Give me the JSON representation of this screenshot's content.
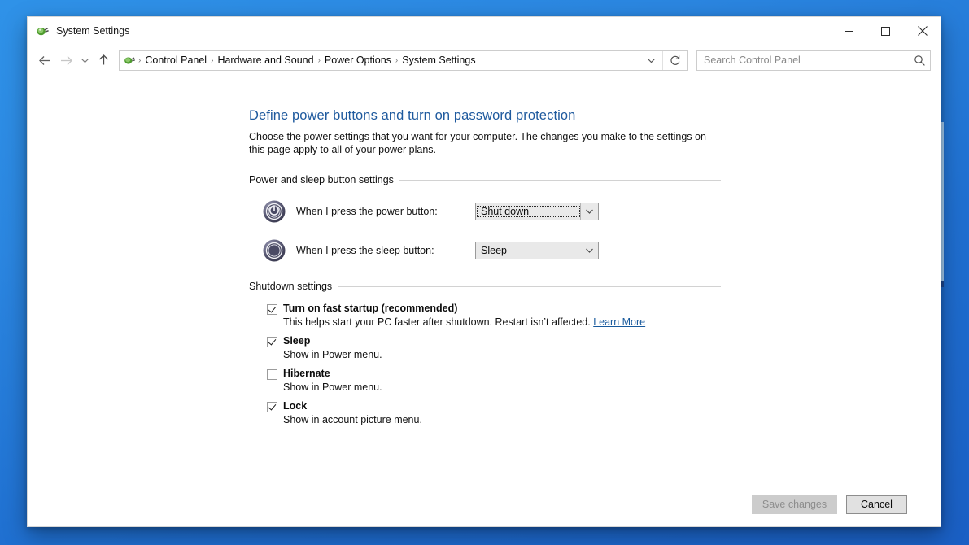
{
  "window": {
    "title": "System Settings",
    "app_icon": "power-plug-icon",
    "controls": {
      "minimize": "minimize-icon",
      "maximize": "maximize-icon",
      "close": "close-icon"
    }
  },
  "addressbar": {
    "back": "back-arrow-icon",
    "forward": "forward-arrow-icon",
    "recent": "chevron-down-icon",
    "up": "up-arrow-icon",
    "breadcrumbs": [
      "Control Panel",
      "Hardware and Sound",
      "Power Options",
      "System Settings"
    ],
    "separator": "›",
    "dropdown": "chevron-down-icon",
    "refresh": "refresh-icon"
  },
  "search": {
    "placeholder": "Search Control Panel",
    "value": "",
    "icon": "search-icon"
  },
  "main": {
    "title": "Define power buttons and turn on password protection",
    "description": "Choose the power settings that you want for your computer. The changes you make to the settings on this page apply to all of your power plans.",
    "groups": [
      {
        "title": "Power and sleep button settings",
        "rows": [
          {
            "icon": "power-button-icon",
            "label": "When I press the power button:",
            "value": "Shut down",
            "focused": true
          },
          {
            "icon": "sleep-button-icon",
            "label": "When I press the sleep button:",
            "value": "Sleep",
            "focused": false
          }
        ]
      },
      {
        "title": "Shutdown settings",
        "checkboxes": [
          {
            "label": "Turn on fast startup (recommended)",
            "checked": true,
            "sub_before": "This helps start your PC faster after shutdown. Restart isn’t affected.",
            "link": "Learn More"
          },
          {
            "label": "Sleep",
            "checked": true,
            "sub": "Show in Power menu."
          },
          {
            "label": "Hibernate",
            "checked": false,
            "sub": "Show in Power menu."
          },
          {
            "label": "Lock",
            "checked": true,
            "sub": "Show in account picture menu."
          }
        ]
      }
    ]
  },
  "footer": {
    "save_label": "Save changes",
    "save_enabled": false,
    "cancel_label": "Cancel"
  },
  "colors": {
    "accent_title": "#1f5a9e",
    "link": "#17599c",
    "desktop": "#2b86e0",
    "window_bg": "#ffffff"
  }
}
